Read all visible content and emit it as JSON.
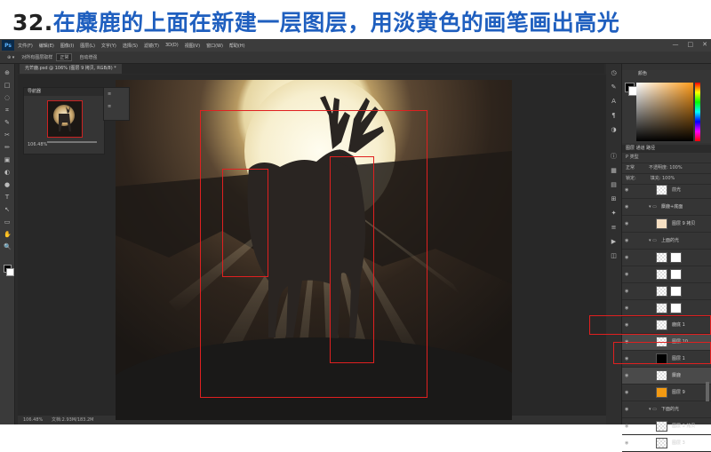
{
  "banner": {
    "number": "32.",
    "title": "在麋鹿的上面在新建一层图层，用淡黄色的画笔画出高光"
  },
  "app": {
    "logo": "Ps",
    "menu": [
      "文件(F)",
      "编辑(E)",
      "图像(I)",
      "图层(L)",
      "文字(Y)",
      "选择(S)",
      "滤镜(T)",
      "3D(D)",
      "视图(V)",
      "窗口(W)",
      "帮助(H)"
    ],
    "window_controls": [
      "—",
      "□",
      "✕"
    ]
  },
  "options_bar": {
    "sample_label": "对所有图层取样",
    "sample_value": "正常",
    "auto_enhance": "自动增强"
  },
  "document_tab": {
    "title": "光芒鹿.psd @ 106% (图层 9 拷贝, RGB/8) *"
  },
  "toolbar": {
    "icons": [
      "⊕",
      "□",
      "◌",
      "⌗",
      "✎",
      "✂",
      "✏",
      "▣",
      "◐",
      "●",
      "T",
      "↖",
      "▭",
      "✋",
      "🔍"
    ]
  },
  "navigator": {
    "title": "导航器",
    "zoom": "106.48%"
  },
  "mini_panel": {
    "items": [
      "≡",
      "≡"
    ]
  },
  "status_bar": {
    "zoom": "106.48%",
    "doc": "文档:2.93M/183.2M"
  },
  "color_panel": {
    "title": "颜色",
    "fg": "#000000",
    "bg": "#ffffff",
    "accent": "#ff9c1a"
  },
  "layers_panel": {
    "tabs": "图层  通道  路径",
    "filter": "P 类型",
    "blend_mode": "正常",
    "opacity_label": "不透明度: 100%",
    "lock_label": "锁定:",
    "fill_label": "填充: 100%",
    "layers": [
      {
        "name": "前光",
        "type": "layer",
        "thumb": "checker"
      },
      {
        "name": "麋鹿+底面",
        "type": "group",
        "thumb": "none"
      },
      {
        "name": "图层 9 拷贝",
        "type": "layer",
        "thumb": "peach",
        "selected": false
      },
      {
        "name": "上面的光",
        "type": "group",
        "thumb": "none"
      },
      {
        "name": "",
        "type": "layer",
        "thumb": "checker",
        "mask": true
      },
      {
        "name": "",
        "type": "layer",
        "thumb": "checker",
        "mask": true
      },
      {
        "name": "",
        "type": "layer",
        "thumb": "checker",
        "mask": true
      },
      {
        "name": "",
        "type": "layer",
        "thumb": "checker",
        "mask": true
      },
      {
        "name": "鹿底 1",
        "type": "layer",
        "thumb": "checker"
      },
      {
        "name": "图层 10",
        "type": "layer",
        "thumb": "checker",
        "selected": true
      },
      {
        "name": "图层 1",
        "type": "layer",
        "thumb": "black"
      },
      {
        "name": "麋鹿",
        "type": "layer",
        "thumb": "checker",
        "selected": true
      },
      {
        "name": "图层 9",
        "type": "layer",
        "thumb": "orange"
      },
      {
        "name": "下面的光",
        "type": "group",
        "thumb": "none"
      },
      {
        "name": "图层 3 拷贝",
        "type": "layer",
        "thumb": "checker"
      },
      {
        "name": "图层 3",
        "type": "layer",
        "thumb": "checker"
      }
    ]
  }
}
